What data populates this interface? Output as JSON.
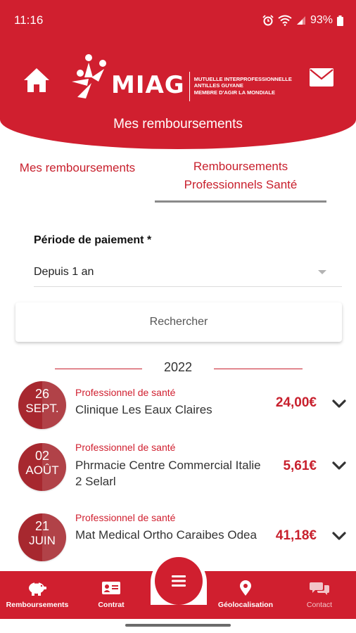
{
  "status_bar": {
    "time": "11:16",
    "battery": "93%"
  },
  "header": {
    "logo_text": "MIAG",
    "logo_tagline": [
      "MUTUELLE INTERPROFESSIONNELLE",
      "ANTILLES GUYANE",
      "MEMBRE D'AGIR LA MONDIALE"
    ],
    "title": "Mes remboursements"
  },
  "tabs": [
    {
      "label": "Mes remboursements",
      "active": false
    },
    {
      "label": "Remboursements Professionnels Santé",
      "active": true
    }
  ],
  "form": {
    "period_label": "Période de paiement *",
    "period_value": "Depuis 1 an",
    "search_label": "Rechercher"
  },
  "year": "2022",
  "items": [
    {
      "day": "26",
      "month": "SEPT.",
      "category": "Professionnel de santé",
      "name": "Clinique Les Eaux Claires",
      "amount": "24,00€"
    },
    {
      "day": "02",
      "month": "AOÛT",
      "category": "Professionnel de santé",
      "name": "Phrmacie Centre Commercial Italie 2 Selarl",
      "amount": "5,61€"
    },
    {
      "day": "21",
      "month": "JUIN",
      "category": "Professionnel de santé",
      "name": "Mat Medical Ortho Caraibes Odea",
      "amount": "41,18€"
    }
  ],
  "bottom_nav": {
    "items": [
      {
        "label": "Remboursements",
        "icon": "piggy-bank-icon"
      },
      {
        "label": "Contrat",
        "icon": "id-card-icon"
      },
      {
        "label": "Géolocalisation",
        "icon": "location-pin-icon"
      },
      {
        "label": "Contact",
        "icon": "chat-bubbles-icon"
      }
    ],
    "center_icon": "menu-icon"
  },
  "colors": {
    "brand_red": "#d01f2f",
    "date_circle": "#a7282f",
    "text_dark": "#333333"
  }
}
